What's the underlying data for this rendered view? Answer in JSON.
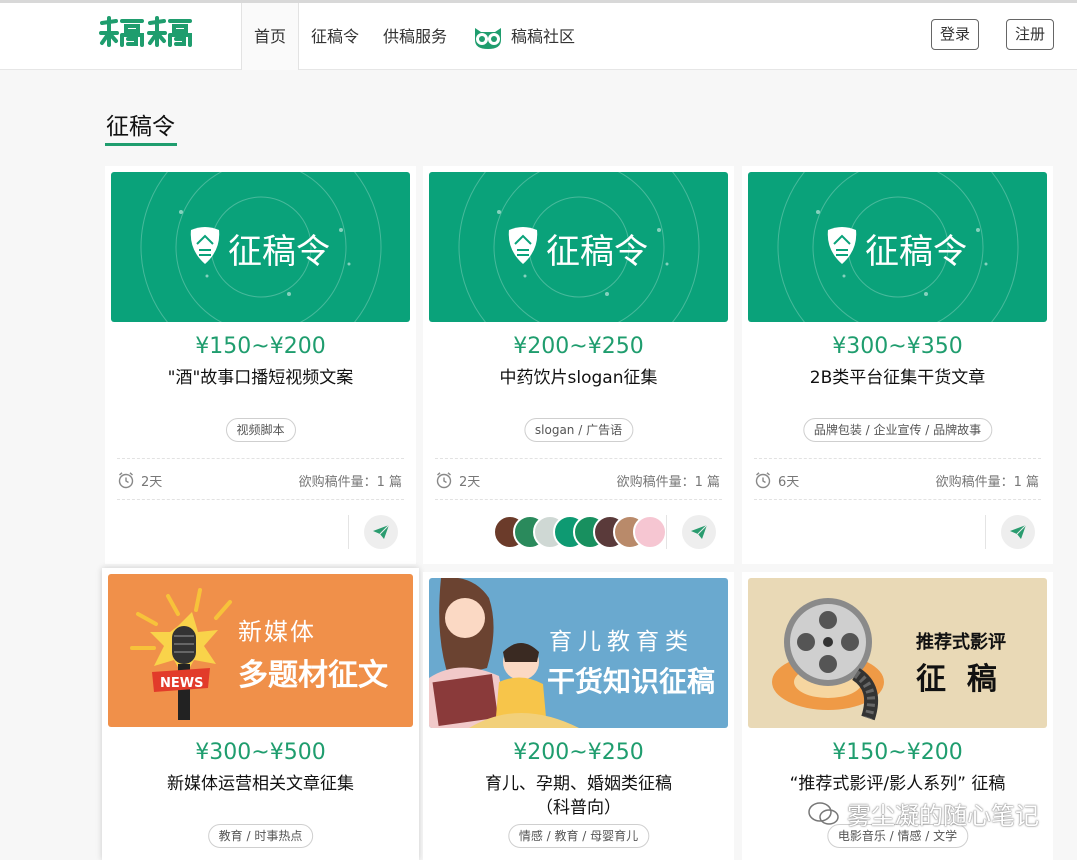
{
  "header": {
    "logo": "稿稿",
    "nav": [
      "首页",
      "征稿令",
      "供稿服务",
      "稿稿社区"
    ],
    "login": "登录",
    "register": "注册"
  },
  "section": {
    "title": "征稿令"
  },
  "banner_text": "征稿令",
  "cards": [
    {
      "price": "¥150~¥200",
      "title": "\"酒\"故事口播短视频文案",
      "tag": "视频脚本",
      "days": "2天",
      "count": "欲购稿件量：1 篇"
    },
    {
      "price": "¥200~¥250",
      "title": "中药饮片slogan征集",
      "tag": "slogan / 广告语",
      "days": "2天",
      "count": "欲购稿件量：1 篇"
    },
    {
      "price": "¥300~¥350",
      "title": "2B类平台征集干货文章",
      "tag": "品牌包装 / 企业宣传 / 品牌故事",
      "days": "6天",
      "count": "欲购稿件量：1 篇"
    },
    {
      "price": "¥300~¥500",
      "title": "新媒体运营相关文章征集",
      "tag": "教育 / 时事热点",
      "banner": {
        "line1": "新媒体",
        "line2": "多题材征文",
        "badge": "NEWS"
      }
    },
    {
      "price": "¥200~¥250",
      "title": "育儿、孕期、婚姻类征稿",
      "title2": "（科普向）",
      "tag": "情感 / 教育 / 母婴育儿",
      "banner": {
        "line1": "育儿教育类",
        "line2": "干货知识征稿"
      }
    },
    {
      "price": "¥150~¥200",
      "title": "“推荐式影评/影人系列” 征稿",
      "tag": "电影音乐 / 情感 / 文学",
      "banner": {
        "line1": "推荐式影评",
        "line2": "征  稿"
      }
    }
  ],
  "watermark": "雾尘凝的随心笔记",
  "colors": {
    "brand": "#1f9d6e",
    "banner_green": "#0aa27a",
    "orange": "#f0904a",
    "blue": "#6aa9cf",
    "beige": "#e9d9b6"
  }
}
